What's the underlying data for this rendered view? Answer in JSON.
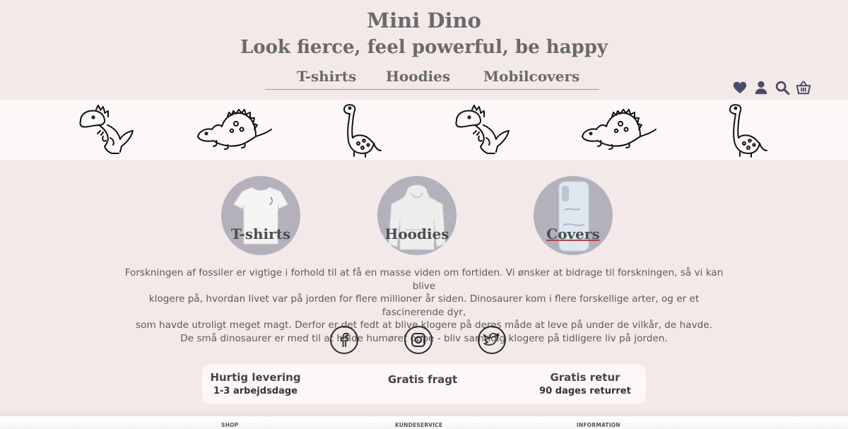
{
  "header": {
    "brand": "Mini Dino",
    "tagline": "Look fierce, feel powerful, be happy"
  },
  "nav": {
    "items": [
      "T-shirts",
      "Hoodies",
      "Mobilcovers"
    ]
  },
  "toolbar_icons": [
    "heart-icon",
    "user-icon",
    "search-icon",
    "basket-icon"
  ],
  "colors": {
    "background": "#f3e9e9",
    "band": "#fcf8f7",
    "category_circle": "#b4b1bc",
    "text": "#595959"
  },
  "categories": [
    {
      "label": "T-shirts",
      "image": "t-shirt"
    },
    {
      "label": "Hoodies",
      "image": "hoodie"
    },
    {
      "label": "Covers",
      "image": "phone-cover"
    }
  ],
  "about": {
    "lines": [
      "Forskningen af fossiler er vigtige i forhold til at få en masse viden om fortiden. Vi ønsker at bidrage til forskningen, så vi kan blive",
      "klogere på, hvordan livet var på jorden for flere millioner år siden. Dinosaurer kom i flere forskellige arter, og er et fascinerende dyr,",
      "som havde utroligt meget magt. Derfor er det fedt at blive klogere på deres måde at leve på under de vilkår, de havde.",
      "De små dinosaurer er med til at holde humøret oppe - bliv samtidig klogere på tidligere liv på jorden."
    ]
  },
  "social": [
    "facebook-icon",
    "instagram-icon",
    "twitter-icon"
  ],
  "perks": [
    {
      "title": "Hurtig levering",
      "sub": "1-3 arbejdsdage"
    },
    {
      "title": "Gratis fragt",
      "sub": ""
    },
    {
      "title": "Gratis retur",
      "sub": "90 dages returret"
    }
  ],
  "footer": {
    "col1": "SHOP",
    "col2": "KUNDESERVICE",
    "col3": "INFORMATION"
  }
}
